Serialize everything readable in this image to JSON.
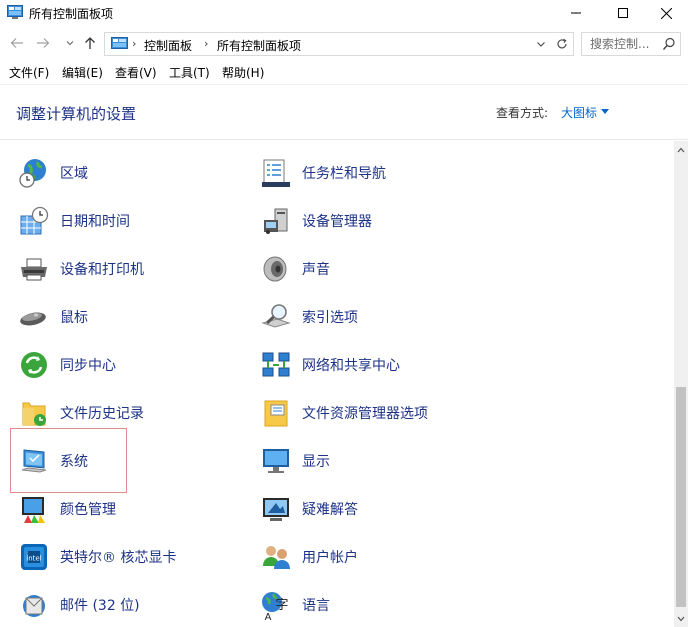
{
  "window": {
    "title": "所有控制面板项"
  },
  "address": {
    "crumbs": [
      "控制面板",
      "所有控制面板项"
    ],
    "sep": "›"
  },
  "search": {
    "placeholder": "搜索控制..."
  },
  "menu": [
    "文件(F)",
    "编辑(E)",
    "查看(V)",
    "工具(T)",
    "帮助(H)"
  ],
  "header": {
    "title": "调整计算机的设置",
    "view_label": "查看方式:",
    "view_value": "大图标"
  },
  "items_left": [
    {
      "label": "区域",
      "icon": "globe-clock-icon"
    },
    {
      "label": "日期和时间",
      "icon": "calendar-clock-icon"
    },
    {
      "label": "设备和打印机",
      "icon": "printer-icon"
    },
    {
      "label": "鼠标",
      "icon": "mouse-icon"
    },
    {
      "label": "同步中心",
      "icon": "sync-icon"
    },
    {
      "label": "文件历史记录",
      "icon": "folder-history-icon"
    },
    {
      "label": "系统",
      "icon": "system-computer-icon"
    },
    {
      "label": "颜色管理",
      "icon": "color-management-icon"
    },
    {
      "label": "英特尔® 核芯显卡",
      "icon": "intel-graphics-icon"
    },
    {
      "label": "邮件 (32 位)",
      "icon": "mail-icon"
    }
  ],
  "items_right": [
    {
      "label": "任务栏和导航",
      "icon": "taskbar-icon"
    },
    {
      "label": "设备管理器",
      "icon": "device-manager-icon"
    },
    {
      "label": "声音",
      "icon": "speaker-icon"
    },
    {
      "label": "索引选项",
      "icon": "indexing-icon"
    },
    {
      "label": "网络和共享中心",
      "icon": "network-icon"
    },
    {
      "label": "文件资源管理器选项",
      "icon": "explorer-options-icon"
    },
    {
      "label": "显示",
      "icon": "display-icon"
    },
    {
      "label": "疑难解答",
      "icon": "troubleshoot-icon"
    },
    {
      "label": "用户帐户",
      "icon": "user-accounts-icon"
    },
    {
      "label": "语言",
      "icon": "language-icon"
    }
  ],
  "selected_item": "系统"
}
